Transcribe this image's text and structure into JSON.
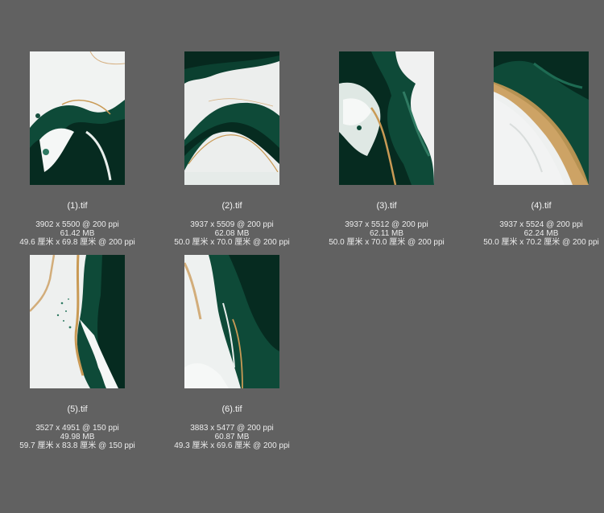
{
  "files": [
    {
      "name": "(1).tif",
      "dims": "3902 x 5500 @ 200 ppi",
      "size": "61.42 MB",
      "print": "49.6 厘米 x 69.8 厘米 @ 200 ppi"
    },
    {
      "name": "(2).tif",
      "dims": "3937 x 5509 @ 200 ppi",
      "size": "62.08 MB",
      "print": "50.0 厘米 x 70.0 厘米 @ 200 ppi"
    },
    {
      "name": "(3).tif",
      "dims": "3937 x 5512 @ 200 ppi",
      "size": "62.11 MB",
      "print": "50.0 厘米 x 70.0 厘米 @ 200 ppi"
    },
    {
      "name": "(4).tif",
      "dims": "3937 x 5524 @ 200 ppi",
      "size": "62.24 MB",
      "print": "50.0 厘米 x 70.2 厘米 @ 200 ppi"
    },
    {
      "name": "(5).tif",
      "dims": "3527 x 4951 @ 150 ppi",
      "size": "49.98 MB",
      "print": "59.7 厘米 x 83.8 厘米 @ 150 ppi"
    },
    {
      "name": "(6).tif",
      "dims": "3883 x 5477 @ 200 ppi",
      "size": "60.87 MB",
      "print": "49.3 厘米 x 69.6 厘米 @ 200 ppi"
    }
  ],
  "colors": {
    "background": "#616161",
    "emerald": "#0e4a38",
    "deep": "#062b20",
    "gold": "#c99a55",
    "marble": "#eef0ef"
  }
}
